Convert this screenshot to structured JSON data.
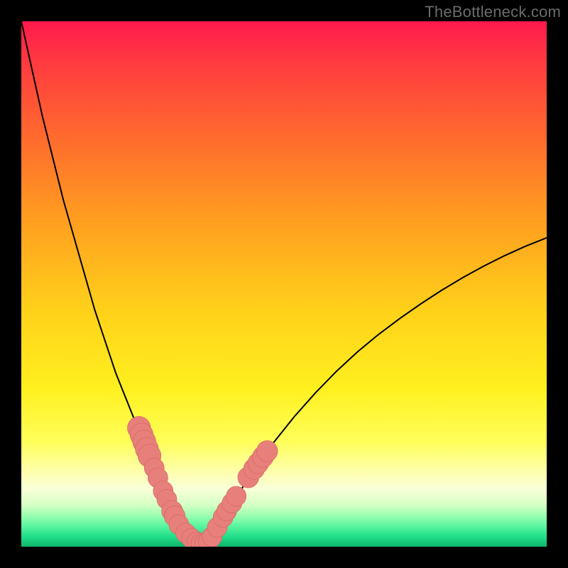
{
  "watermark": "TheBottleneck.com",
  "colors": {
    "frame": "#000000",
    "curve_stroke": "#000000",
    "marker_fill": "#e77f7b",
    "marker_stroke": "#d46561"
  },
  "chart_data": {
    "type": "line",
    "title": "",
    "xlabel": "",
    "ylabel": "",
    "xlim": [
      0,
      100
    ],
    "ylim": [
      0,
      100
    ],
    "grid": false,
    "legend": false,
    "x": [
      0,
      2,
      4,
      6,
      8,
      10,
      12,
      14,
      16,
      18,
      20,
      22,
      23,
      24,
      25,
      26,
      27,
      28,
      29,
      30,
      31,
      32,
      34,
      36,
      38,
      40,
      44,
      48,
      52,
      56,
      60,
      64,
      68,
      72,
      76,
      80,
      84,
      88,
      92,
      96,
      100
    ],
    "series": [
      {
        "name": "bottleneck-curve",
        "values": [
          100,
          91,
          82,
          74,
          66,
          59,
          52,
          45,
          39,
          33,
          28,
          23,
          20.6,
          18.3,
          16,
          13.7,
          11.5,
          9.2,
          7,
          5,
          3.4,
          2,
          0.8,
          1.6,
          4.6,
          8,
          14.2,
          19.8,
          24.8,
          29.3,
          33.4,
          37.1,
          40.4,
          43.4,
          46.2,
          48.8,
          51.2,
          53.4,
          55.4,
          57.2,
          58.8
        ]
      }
    ],
    "markers": [
      {
        "x": 22.4,
        "y": 22.6,
        "r": 2.2
      },
      {
        "x": 22.9,
        "y": 21.3,
        "r": 2.2
      },
      {
        "x": 23.4,
        "y": 20.0,
        "r": 2.2
      },
      {
        "x": 23.9,
        "y": 18.6,
        "r": 2.2
      },
      {
        "x": 24.4,
        "y": 17.3,
        "r": 2.2
      },
      {
        "x": 25.3,
        "y": 15.0,
        "r": 1.9
      },
      {
        "x": 26.0,
        "y": 13.1,
        "r": 1.9
      },
      {
        "x": 27.0,
        "y": 10.6,
        "r": 1.9
      },
      {
        "x": 27.7,
        "y": 9.0,
        "r": 1.9
      },
      {
        "x": 28.7,
        "y": 6.8,
        "r": 2.0
      },
      {
        "x": 29.2,
        "y": 5.8,
        "r": 2.0
      },
      {
        "x": 30.0,
        "y": 4.2,
        "r": 1.9
      },
      {
        "x": 31.3,
        "y": 2.6,
        "r": 1.9
      },
      {
        "x": 32.4,
        "y": 1.6,
        "r": 1.9
      },
      {
        "x": 33.4,
        "y": 0.9,
        "r": 1.9
      },
      {
        "x": 34.2,
        "y": 0.6,
        "r": 1.9
      },
      {
        "x": 34.9,
        "y": 0.6,
        "r": 1.9
      },
      {
        "x": 35.6,
        "y": 1.0,
        "r": 1.9
      },
      {
        "x": 36.3,
        "y": 1.9,
        "r": 1.9
      },
      {
        "x": 37.3,
        "y": 3.7,
        "r": 1.9
      },
      {
        "x": 38.4,
        "y": 5.6,
        "r": 1.9
      },
      {
        "x": 39.1,
        "y": 6.8,
        "r": 1.9
      },
      {
        "x": 40.1,
        "y": 8.3,
        "r": 1.9
      },
      {
        "x": 40.9,
        "y": 9.6,
        "r": 1.9
      },
      {
        "x": 43.2,
        "y": 13.2,
        "r": 2.0
      },
      {
        "x": 44.3,
        "y": 14.8,
        "r": 2.0
      },
      {
        "x": 45.1,
        "y": 15.9,
        "r": 2.0
      },
      {
        "x": 46.0,
        "y": 17.1,
        "r": 2.0
      },
      {
        "x": 46.8,
        "y": 18.2,
        "r": 2.0
      }
    ]
  }
}
